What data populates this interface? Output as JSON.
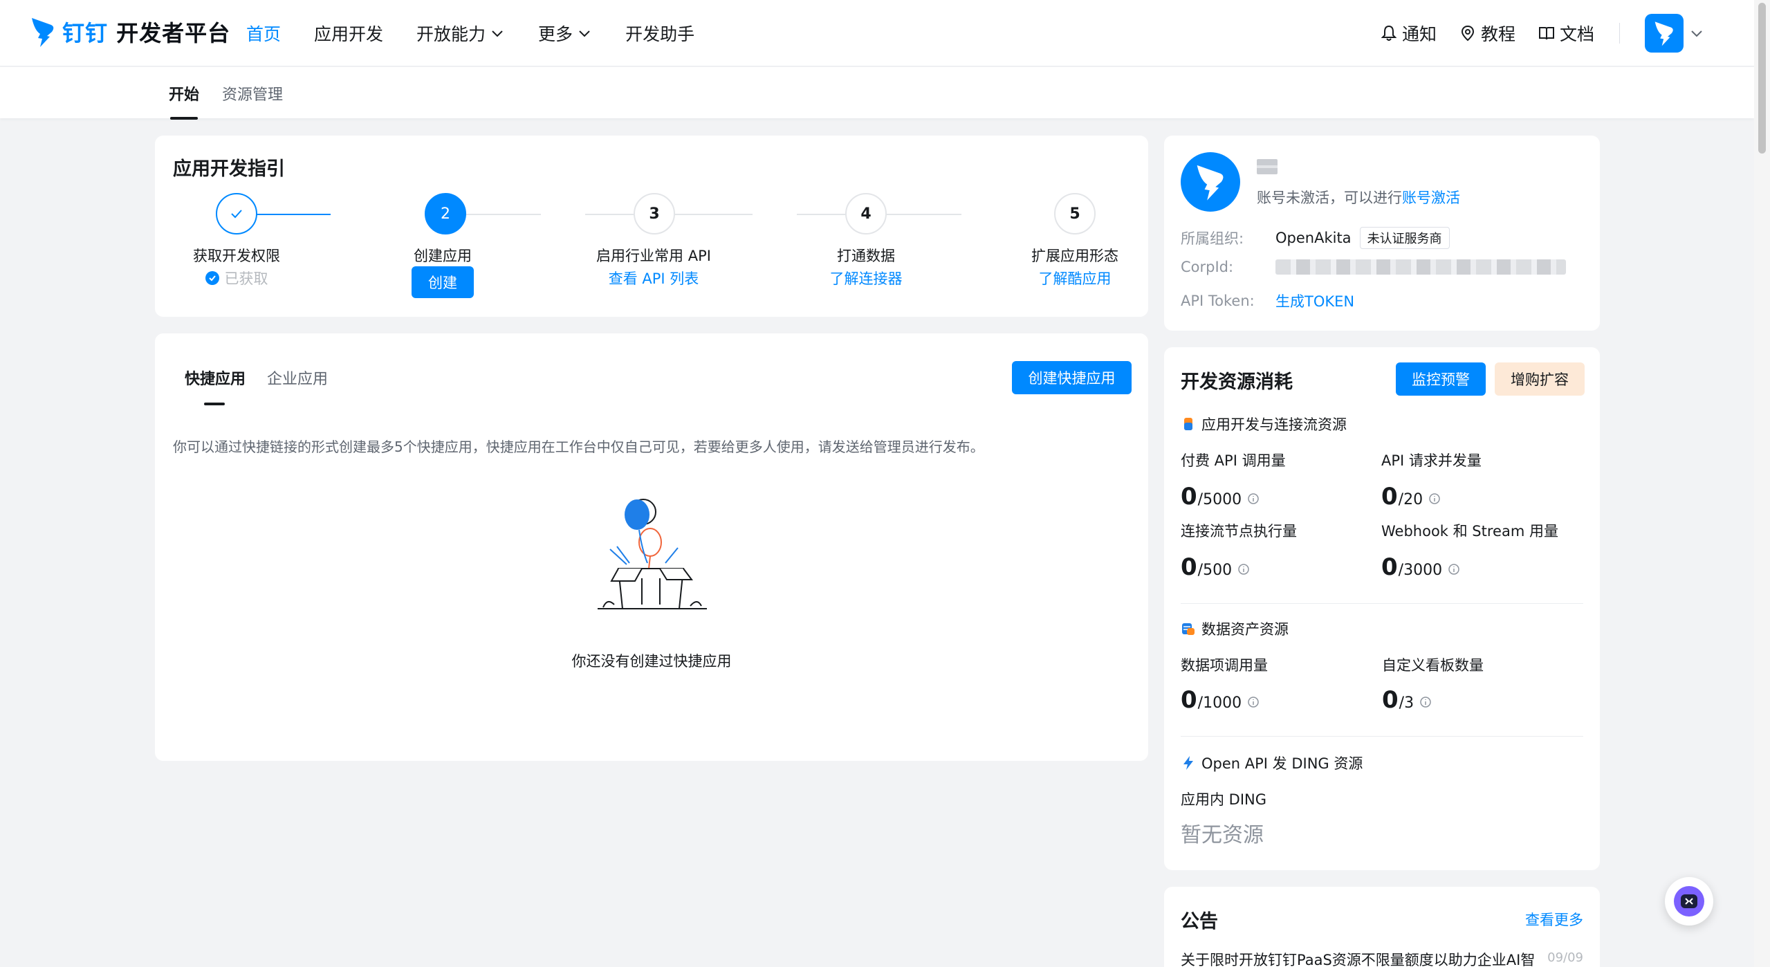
{
  "header": {
    "brand_logo": "钉钉",
    "brand_name": "开发者平台",
    "nav": [
      {
        "label": "首页",
        "active": true
      },
      {
        "label": "应用开发"
      },
      {
        "label": "开放能力",
        "dropdown": true
      },
      {
        "label": "更多",
        "dropdown": true
      },
      {
        "label": "开发助手"
      }
    ],
    "tools": [
      {
        "label": "通知",
        "icon": "bell-icon"
      },
      {
        "label": "教程",
        "icon": "location-pin-icon"
      },
      {
        "label": "文档",
        "icon": "book-icon"
      }
    ],
    "accent_color": "#0089ff"
  },
  "subtabs": [
    {
      "label": "开始",
      "active": true
    },
    {
      "label": "资源管理"
    }
  ],
  "guide": {
    "title": "应用开发指引",
    "steps": [
      {
        "index": "1",
        "label": "获取开发权限",
        "sub": "已获取",
        "state": "done"
      },
      {
        "index": "2",
        "label": "创建应用",
        "action": "创建",
        "state": "current"
      },
      {
        "index": "3",
        "label": "启用行业常用 API",
        "sub": "查看 API 列表",
        "state": "todo"
      },
      {
        "index": "4",
        "label": "打通数据",
        "sub": "了解连接器",
        "state": "todo"
      },
      {
        "index": "5",
        "label": "扩展应用形态",
        "sub": "了解酷应用",
        "state": "todo"
      }
    ]
  },
  "apps": {
    "tabs": [
      {
        "label": "快捷应用",
        "active": true
      },
      {
        "label": "企业应用"
      }
    ],
    "create_button": "创建快捷应用",
    "description": "你可以通过快捷链接的形式创建最多5个快捷应用，快捷应用在工作台中仅自己可见，若要给更多人使用，请发送给管理员进行发布。",
    "empty_text": "你还没有创建过快捷应用"
  },
  "account": {
    "status_prefix": "账号未激活，可以进行",
    "status_link": "账号激活",
    "org_label": "所属组织:",
    "org_value": "OpenAkita",
    "org_tag": "未认证服务商",
    "corpid_label": "CorpId:",
    "token_label": "API Token:",
    "token_link": "生成TOKEN"
  },
  "resources": {
    "title": "开发资源消耗",
    "monitor_button": "监控预警",
    "expand_button": "增购扩容",
    "sections": [
      {
        "title": "应用开发与连接流资源",
        "metrics": [
          {
            "label": "付费 API 调用量",
            "used": "0",
            "limit": "/5000"
          },
          {
            "label": "API 请求并发量",
            "used": "0",
            "limit": "/20"
          },
          {
            "label": "连接流节点执行量",
            "used": "0",
            "limit": "/500"
          },
          {
            "label": "Webhook 和 Stream 用量",
            "used": "0",
            "limit": "/3000"
          }
        ]
      },
      {
        "title": "数据资产资源",
        "metrics": [
          {
            "label": "数据项调用量",
            "used": "0",
            "limit": "/1000"
          },
          {
            "label": "自定义看板数量",
            "used": "0",
            "limit": "/3"
          }
        ]
      },
      {
        "title": "Open API 发 DING 资源",
        "metrics": [
          {
            "label": "应用内 DING",
            "empty": "暂无资源"
          }
        ]
      }
    ]
  },
  "notice": {
    "title": "公告",
    "more": "查看更多",
    "items": [
      {
        "text": "关于限时开放钉钉PaaS资源不限量额度以助力企业AI智",
        "date": "09/09"
      }
    ]
  }
}
